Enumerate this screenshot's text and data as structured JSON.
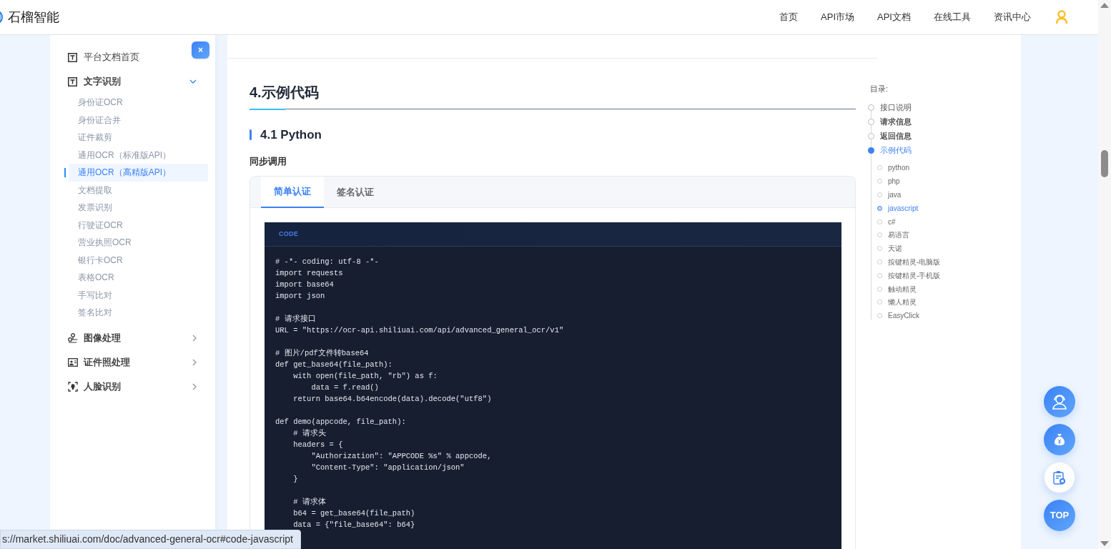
{
  "header": {
    "logo_text": "石榴智能",
    "nav": [
      {
        "label": "首页"
      },
      {
        "label": "API市场"
      },
      {
        "label": "API文档"
      },
      {
        "label": "在线工具"
      },
      {
        "label": "资讯中心"
      }
    ]
  },
  "sidebar": {
    "close": "×",
    "items": [
      {
        "label": "平台文档首页",
        "kind": "text"
      },
      {
        "label": "文字识别",
        "kind": "text",
        "expanded": true,
        "children": [
          {
            "label": "身份证OCR",
            "selected": false
          },
          {
            "label": "身份证合并",
            "selected": false
          },
          {
            "label": "证件裁剪",
            "selected": false
          },
          {
            "label": "通用OCR（标准版API）",
            "selected": false
          },
          {
            "label": "通用OCR（高精版API）",
            "selected": true
          },
          {
            "label": "文档提取",
            "selected": false
          },
          {
            "label": "发票识别",
            "selected": false
          },
          {
            "label": "行驶证OCR",
            "selected": false
          },
          {
            "label": "营业执照OCR",
            "selected": false
          },
          {
            "label": "银行卡OCR",
            "selected": false
          },
          {
            "label": "表格OCR",
            "selected": false
          },
          {
            "label": "手写比对",
            "selected": false
          },
          {
            "label": "签名比对",
            "selected": false
          }
        ]
      },
      {
        "label": "图像处理",
        "kind": "image",
        "expanded": false
      },
      {
        "label": "证件照处理",
        "kind": "idphoto",
        "expanded": false
      },
      {
        "label": "人脸识别",
        "kind": "face",
        "expanded": false
      }
    ]
  },
  "content": {
    "heading": "4.示例代码",
    "subheading": "4.1 Python",
    "section_label": "同步调用",
    "tabs": [
      {
        "label": "简单认证",
        "selected": true
      },
      {
        "label": "签名认证",
        "selected": false
      }
    ],
    "code_label": "CODE",
    "code": "# -*- coding: utf-8 -*-\nimport requests\nimport base64\nimport json\n\n# 请求接口\nURL = \"https://ocr-api.shiliuai.com/api/advanced_general_ocr/v1\"\n\n# 图片/pdf文件转base64\ndef get_base64(file_path):\n    with open(file_path, \"rb\") as f:\n        data = f.read()\n    return base64.b64encode(data).decode(\"utf8\")\n\ndef demo(appcode, file_path):\n    # 请求头\n    headers = {\n        \"Authorization\": \"APPCODE %s\" % appcode,\n        \"Content-Type\": \"application/json\"\n    }\n\n    # 请求体\n    b64 = get_base64(file_path)\n    data = {\"file_base64\": b64}"
  },
  "toc": {
    "title": "目录:",
    "items": [
      {
        "label": "接口说明",
        "selected": false,
        "bold": false
      },
      {
        "label": "请求信息",
        "selected": false,
        "bold": true
      },
      {
        "label": "返回信息",
        "selected": false,
        "bold": true
      },
      {
        "label": "示例代码",
        "selected": true,
        "bold": false,
        "children": [
          {
            "label": "python",
            "selected": false
          },
          {
            "label": "php",
            "selected": false
          },
          {
            "label": "java",
            "selected": false
          },
          {
            "label": "javascript",
            "selected": true
          },
          {
            "label": "c#",
            "selected": false
          },
          {
            "label": "易语言",
            "selected": false
          },
          {
            "label": "天诺",
            "selected": false
          },
          {
            "label": "按键精灵-电脑版",
            "selected": false
          },
          {
            "label": "按键精灵-手机版",
            "selected": false
          },
          {
            "label": "触动精灵",
            "selected": false
          },
          {
            "label": "懒人精灵",
            "selected": false
          },
          {
            "label": "EasyClick",
            "selected": false
          }
        ]
      }
    ]
  },
  "float_buttons": [
    {
      "kind": "support"
    },
    {
      "kind": "money"
    },
    {
      "kind": "clipboard"
    },
    {
      "kind": "top",
      "label": "TOP"
    }
  ],
  "status_url": "s://market.shiliuai.com/doc/advanced-general-ocr#code-javascript"
}
